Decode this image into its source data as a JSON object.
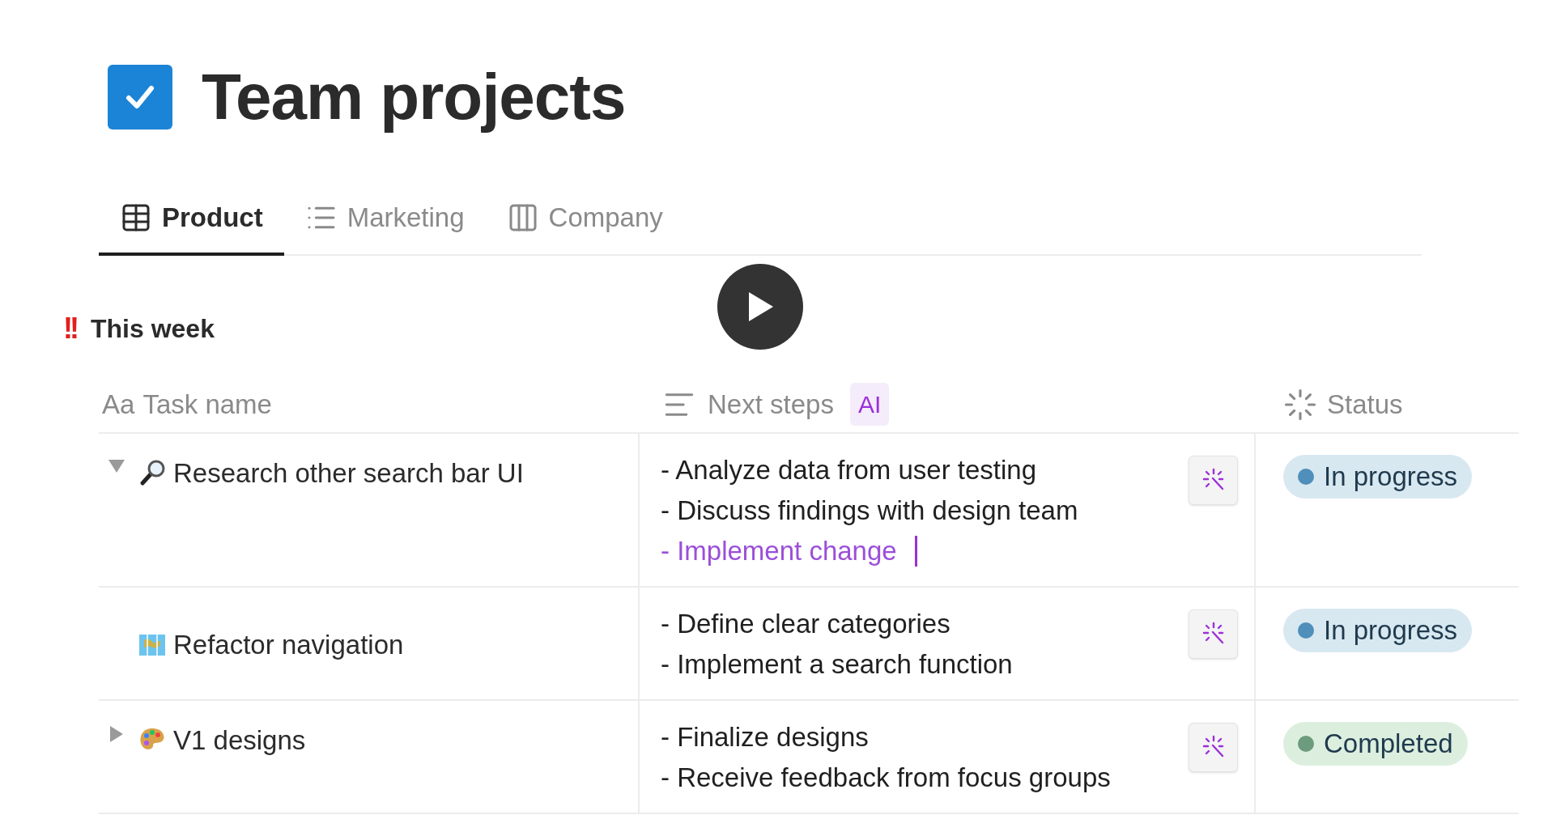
{
  "page": {
    "title": "Team projects",
    "checked": true
  },
  "tabs": [
    {
      "label": "Product",
      "selected": true
    },
    {
      "label": "Marketing",
      "selected": false
    },
    {
      "label": "Company",
      "selected": false
    }
  ],
  "group": {
    "marker": "!!",
    "title": "This week"
  },
  "table": {
    "columns": [
      {
        "prefix": "Aa",
        "label": "Task name"
      },
      {
        "label": "Next steps",
        "badge": "AI"
      },
      {
        "label": "Status"
      }
    ],
    "rows": [
      {
        "name": "Research other search bar UI",
        "has_toggle": true,
        "expanded": true,
        "steps": [
          {
            "text": "- Analyze data from user testing",
            "kind": "plain"
          },
          {
            "text": "- Discuss findings with design team",
            "kind": "plain"
          },
          {
            "text": "- Implement change",
            "kind": "generating"
          }
        ],
        "status": {
          "label": "In progress",
          "kind": "in_progress",
          "color": "#4f8fba"
        }
      },
      {
        "name": "Refactor navigation",
        "has_toggle": false,
        "steps": [
          {
            "text": "- Define clear categories",
            "kind": "plain"
          },
          {
            "text": "- Implement a search function",
            "kind": "plain"
          }
        ],
        "status": {
          "label": "In progress",
          "kind": "in_progress",
          "color": "#4f8fba"
        }
      },
      {
        "name": "V1 designs",
        "has_toggle": true,
        "expanded": false,
        "steps": [
          {
            "text": "- Finalize designs",
            "kind": "plain"
          },
          {
            "text": "- Receive feedback from focus groups",
            "kind": "plain"
          }
        ],
        "status": {
          "label": "Completed",
          "kind": "completed",
          "color": "#6c9b7d"
        }
      }
    ]
  },
  "video": {
    "paused": true
  }
}
